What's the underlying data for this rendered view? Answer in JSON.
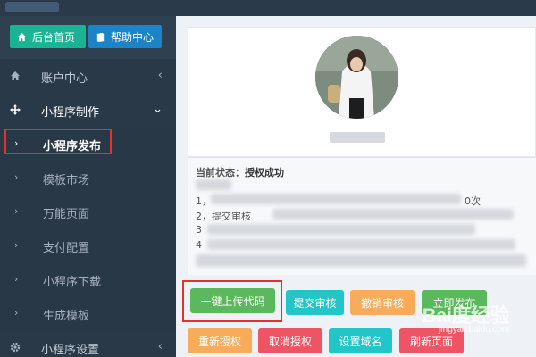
{
  "quick_links": {
    "home_label": "后台首页",
    "help_label": "帮助中心"
  },
  "nav": {
    "account": "账户中心",
    "miniapp_make": "小程序制作",
    "miniapp_publish": "小程序发布",
    "template_market": "模板市场",
    "universal_page": "万能页面",
    "payment_config": "支付配置",
    "miniapp_download": "小程序下载",
    "generate_template": "生成模板",
    "miniapp_settings": "小程序设置"
  },
  "status": {
    "label": "当前状态：",
    "value": "授权成功",
    "line1": "1，",
    "line2": "2，提交审核",
    "line3": "3",
    "line4": "4",
    "line1_tail": "0次"
  },
  "buttons": {
    "upload_code": "一键上传代码",
    "submit_review": "提交审核",
    "withdraw_review": "撤销审核",
    "publish_now": "立即发布",
    "reauthorize": "重新授权",
    "cancel_auth": "取消授权",
    "set_domain": "设置域名",
    "refresh_page": "刷新页面"
  },
  "watermark": {
    "brand": "Bai度经验",
    "sub": "jingyan.baidu.com"
  },
  "colors": {
    "sidebar_bg": "#2f4050",
    "highlight_border": "#e0332b",
    "green": "#5cb85c",
    "teal": "#23c6c8",
    "orange": "#f8ac59",
    "red": "#ed5565",
    "blue": "#1c84c6"
  },
  "icons": {
    "home": "home-icon",
    "help": "book-icon",
    "account": "home-icon",
    "miniapp_make": "move-arrows-icon",
    "miniapp_settings": "gear-icon"
  }
}
